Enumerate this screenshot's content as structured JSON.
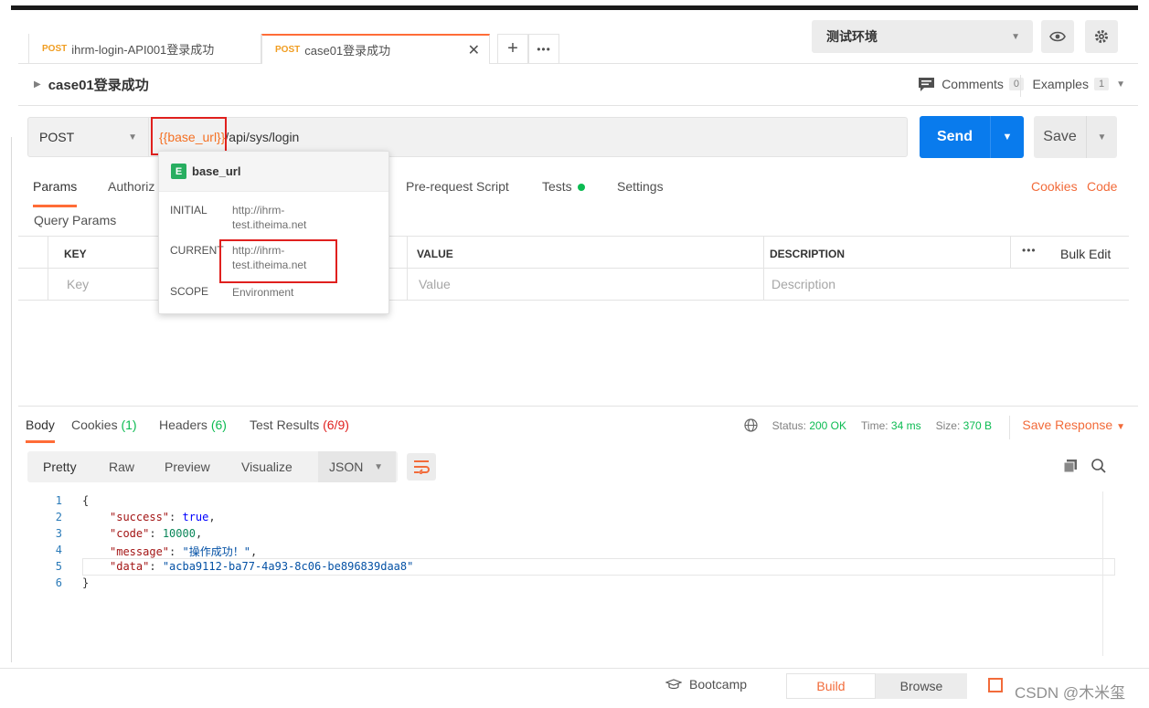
{
  "tabs": [
    {
      "method": "POST",
      "label": "ihrm-login-API001登录成功"
    },
    {
      "method": "POST",
      "label": "case01登录成功"
    }
  ],
  "environment": {
    "selected": "测试环境"
  },
  "request": {
    "name": "case01登录成功",
    "comments_label": "Comments",
    "comments_count": "0",
    "examples_label": "Examples",
    "examples_count": "1",
    "method": "POST",
    "url_var": "{{base_url}}",
    "url_path": "/api/sys/login",
    "send_label": "Send",
    "save_label": "Save"
  },
  "request_tabs": {
    "params": "Params",
    "authorization": "Authoriz",
    "prerequest": "Pre-request Script",
    "tests": "Tests",
    "settings": "Settings",
    "cookies": "Cookies",
    "code": "Code"
  },
  "query_params": {
    "title": "Query Params",
    "col_key": "KEY",
    "col_value": "VALUE",
    "col_desc": "DESCRIPTION",
    "bulk_edit": "Bulk Edit",
    "ph_key": "Key",
    "ph_value": "Value",
    "ph_desc": "Description"
  },
  "variable_popup": {
    "badge": "E",
    "name": "base_url",
    "initial_label": "INITIAL",
    "initial_value": "http://ihrm-test.itheima.net",
    "current_label": "CURRENT",
    "current_value": "http://ihrm-test.itheima.net",
    "scope_label": "SCOPE",
    "scope_value": "Environment"
  },
  "response": {
    "tab_body": "Body",
    "tab_cookies": "Cookies",
    "tab_cookies_count": "(1)",
    "tab_headers": "Headers",
    "tab_headers_count": "(6)",
    "tab_tests": "Test Results",
    "tab_tests_count": "(6/9)",
    "status_label": "Status:",
    "status_value": "200 OK",
    "time_label": "Time:",
    "time_value": "34 ms",
    "size_label": "Size:",
    "size_value": "370 B",
    "save_response": "Save Response",
    "views": [
      "Pretty",
      "Raw",
      "Preview",
      "Visualize"
    ],
    "format": "JSON"
  },
  "code_lines": {
    "l1_num": "1",
    "l2_num": "2",
    "l3_num": "3",
    "l4_num": "4",
    "l5_num": "5",
    "l6_num": "6",
    "open": "{",
    "close": "}",
    "k1": "\"success\"",
    "v1": "true",
    "k2": "\"code\"",
    "v2": "10000",
    "k3": "\"message\"",
    "v3": "\"操作成功！\"",
    "k4": "\"data\"",
    "v4": "\"acba9112-ba77-4a93-8c06-be896839daa8\""
  },
  "statusbar": {
    "bootcamp": "Bootcamp",
    "build": "Build",
    "browse": "Browse",
    "watermark": "CSDN @木米玺"
  },
  "colors": {
    "accent": "#ff6c37",
    "send": "#097bed",
    "highlight_box": "#e0201e",
    "status_ok": "#0cbb52"
  }
}
